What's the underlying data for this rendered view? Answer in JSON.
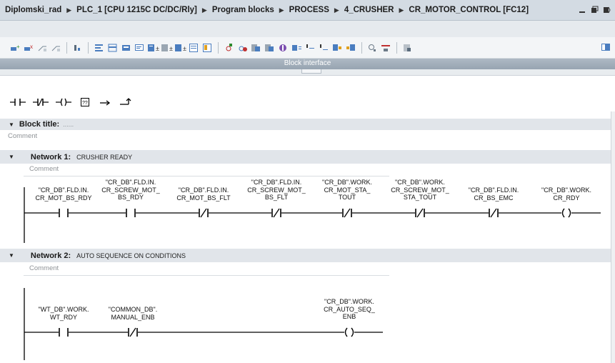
{
  "title_bar": {
    "breadcrumb": [
      "Diplomski_rad",
      "PLC_1 [CPU 1215C DC/DC/Rly]",
      "Program blocks",
      "PROCESS",
      "4_CRUSHER",
      "CR_MOTOR_CONTROL [FC12]"
    ]
  },
  "editor": {
    "block_interface_label": "Block interface"
  },
  "block": {
    "title_label": "Block title:",
    "title_placeholder": "......",
    "comment": "Comment"
  },
  "networks": [
    {
      "header": "Network 1:",
      "name": "CRUSHER READY",
      "comment": "Comment",
      "elements": [
        {
          "type": "NO",
          "operand": "\"CR_DB\".FLD.IN.\nCR_MOT_BS_RDY"
        },
        {
          "type": "NO",
          "operand": "\"CR_DB\".FLD.IN.\nCR_SCREW_MOT_\nBS_RDY"
        },
        {
          "type": "NC",
          "operand": "\"CR_DB\".FLD.IN.\nCR_MOT_BS_FLT"
        },
        {
          "type": "NC",
          "operand": "\"CR_DB\".FLD.IN.\nCR_SCREW_MOT_\nBS_FLT"
        },
        {
          "type": "NC",
          "operand": "\"CR_DB\".WORK.\nCR_MOT_STA_\nTOUT"
        },
        {
          "type": "NC",
          "operand": "\"CR_DB\".WORK.\nCR_SCREW_MOT_\nSTA_TOUT"
        },
        {
          "type": "NC",
          "operand": "\"CR_DB\".FLD.IN.\nCR_BS_EMC"
        },
        {
          "type": "COIL",
          "operand": "\"CR_DB\".WORK.\nCR_RDY"
        }
      ]
    },
    {
      "header": "Network 2:",
      "name": "AUTO SEQUENCE ON CONDITIONS",
      "comment": "Comment",
      "elements": [
        {
          "type": "NO",
          "operand": "\"WT_DB\".WORK.\nWT_RDY"
        },
        {
          "type": "NC",
          "operand": "\"COMMON_DB\".\nMANUAL_ENB"
        },
        {
          "type": "COIL",
          "operand": "\"CR_DB\".WORK.\nCR_AUTO_SEQ_\nENB"
        }
      ]
    }
  ],
  "colors": {
    "title_bar_bg": "#d3dbe3",
    "network_header_bg": "#e1e5ea",
    "block_interface_bg": "#a3afbb",
    "rung_line": "#000000"
  },
  "icons": [
    "window-minimize-icon",
    "window-restore-icon",
    "window-close-icon",
    "normally-open-contact-icon",
    "normally-closed-contact-icon",
    "coil-icon",
    "empty-box-icon",
    "open-branch-icon",
    "close-branch-icon"
  ]
}
